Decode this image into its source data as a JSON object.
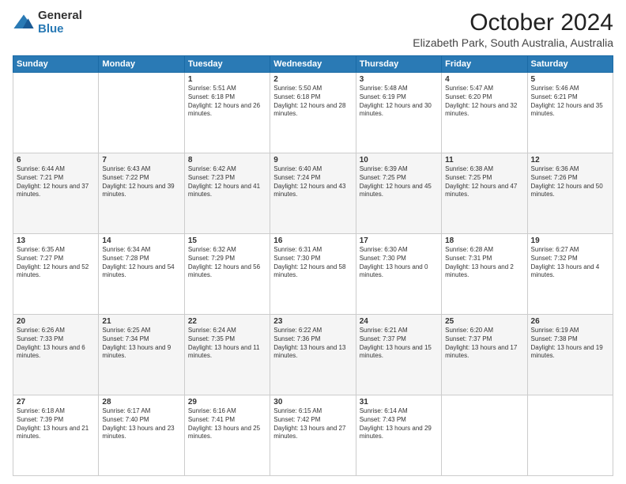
{
  "logo": {
    "general": "General",
    "blue": "Blue"
  },
  "title": "October 2024",
  "location": "Elizabeth Park, South Australia, Australia",
  "days_of_week": [
    "Sunday",
    "Monday",
    "Tuesday",
    "Wednesday",
    "Thursday",
    "Friday",
    "Saturday"
  ],
  "weeks": [
    [
      {
        "day": "",
        "info": ""
      },
      {
        "day": "",
        "info": ""
      },
      {
        "day": "1",
        "info": "Sunrise: 5:51 AM\nSunset: 6:18 PM\nDaylight: 12 hours and 26 minutes."
      },
      {
        "day": "2",
        "info": "Sunrise: 5:50 AM\nSunset: 6:18 PM\nDaylight: 12 hours and 28 minutes."
      },
      {
        "day": "3",
        "info": "Sunrise: 5:48 AM\nSunset: 6:19 PM\nDaylight: 12 hours and 30 minutes."
      },
      {
        "day": "4",
        "info": "Sunrise: 5:47 AM\nSunset: 6:20 PM\nDaylight: 12 hours and 32 minutes."
      },
      {
        "day": "5",
        "info": "Sunrise: 5:46 AM\nSunset: 6:21 PM\nDaylight: 12 hours and 35 minutes."
      }
    ],
    [
      {
        "day": "6",
        "info": "Sunrise: 6:44 AM\nSunset: 7:21 PM\nDaylight: 12 hours and 37 minutes."
      },
      {
        "day": "7",
        "info": "Sunrise: 6:43 AM\nSunset: 7:22 PM\nDaylight: 12 hours and 39 minutes."
      },
      {
        "day": "8",
        "info": "Sunrise: 6:42 AM\nSunset: 7:23 PM\nDaylight: 12 hours and 41 minutes."
      },
      {
        "day": "9",
        "info": "Sunrise: 6:40 AM\nSunset: 7:24 PM\nDaylight: 12 hours and 43 minutes."
      },
      {
        "day": "10",
        "info": "Sunrise: 6:39 AM\nSunset: 7:25 PM\nDaylight: 12 hours and 45 minutes."
      },
      {
        "day": "11",
        "info": "Sunrise: 6:38 AM\nSunset: 7:25 PM\nDaylight: 12 hours and 47 minutes."
      },
      {
        "day": "12",
        "info": "Sunrise: 6:36 AM\nSunset: 7:26 PM\nDaylight: 12 hours and 50 minutes."
      }
    ],
    [
      {
        "day": "13",
        "info": "Sunrise: 6:35 AM\nSunset: 7:27 PM\nDaylight: 12 hours and 52 minutes."
      },
      {
        "day": "14",
        "info": "Sunrise: 6:34 AM\nSunset: 7:28 PM\nDaylight: 12 hours and 54 minutes."
      },
      {
        "day": "15",
        "info": "Sunrise: 6:32 AM\nSunset: 7:29 PM\nDaylight: 12 hours and 56 minutes."
      },
      {
        "day": "16",
        "info": "Sunrise: 6:31 AM\nSunset: 7:30 PM\nDaylight: 12 hours and 58 minutes."
      },
      {
        "day": "17",
        "info": "Sunrise: 6:30 AM\nSunset: 7:30 PM\nDaylight: 13 hours and 0 minutes."
      },
      {
        "day": "18",
        "info": "Sunrise: 6:28 AM\nSunset: 7:31 PM\nDaylight: 13 hours and 2 minutes."
      },
      {
        "day": "19",
        "info": "Sunrise: 6:27 AM\nSunset: 7:32 PM\nDaylight: 13 hours and 4 minutes."
      }
    ],
    [
      {
        "day": "20",
        "info": "Sunrise: 6:26 AM\nSunset: 7:33 PM\nDaylight: 13 hours and 6 minutes."
      },
      {
        "day": "21",
        "info": "Sunrise: 6:25 AM\nSunset: 7:34 PM\nDaylight: 13 hours and 9 minutes."
      },
      {
        "day": "22",
        "info": "Sunrise: 6:24 AM\nSunset: 7:35 PM\nDaylight: 13 hours and 11 minutes."
      },
      {
        "day": "23",
        "info": "Sunrise: 6:22 AM\nSunset: 7:36 PM\nDaylight: 13 hours and 13 minutes."
      },
      {
        "day": "24",
        "info": "Sunrise: 6:21 AM\nSunset: 7:37 PM\nDaylight: 13 hours and 15 minutes."
      },
      {
        "day": "25",
        "info": "Sunrise: 6:20 AM\nSunset: 7:37 PM\nDaylight: 13 hours and 17 minutes."
      },
      {
        "day": "26",
        "info": "Sunrise: 6:19 AM\nSunset: 7:38 PM\nDaylight: 13 hours and 19 minutes."
      }
    ],
    [
      {
        "day": "27",
        "info": "Sunrise: 6:18 AM\nSunset: 7:39 PM\nDaylight: 13 hours and 21 minutes."
      },
      {
        "day": "28",
        "info": "Sunrise: 6:17 AM\nSunset: 7:40 PM\nDaylight: 13 hours and 23 minutes."
      },
      {
        "day": "29",
        "info": "Sunrise: 6:16 AM\nSunset: 7:41 PM\nDaylight: 13 hours and 25 minutes."
      },
      {
        "day": "30",
        "info": "Sunrise: 6:15 AM\nSunset: 7:42 PM\nDaylight: 13 hours and 27 minutes."
      },
      {
        "day": "31",
        "info": "Sunrise: 6:14 AM\nSunset: 7:43 PM\nDaylight: 13 hours and 29 minutes."
      },
      {
        "day": "",
        "info": ""
      },
      {
        "day": "",
        "info": ""
      }
    ]
  ]
}
